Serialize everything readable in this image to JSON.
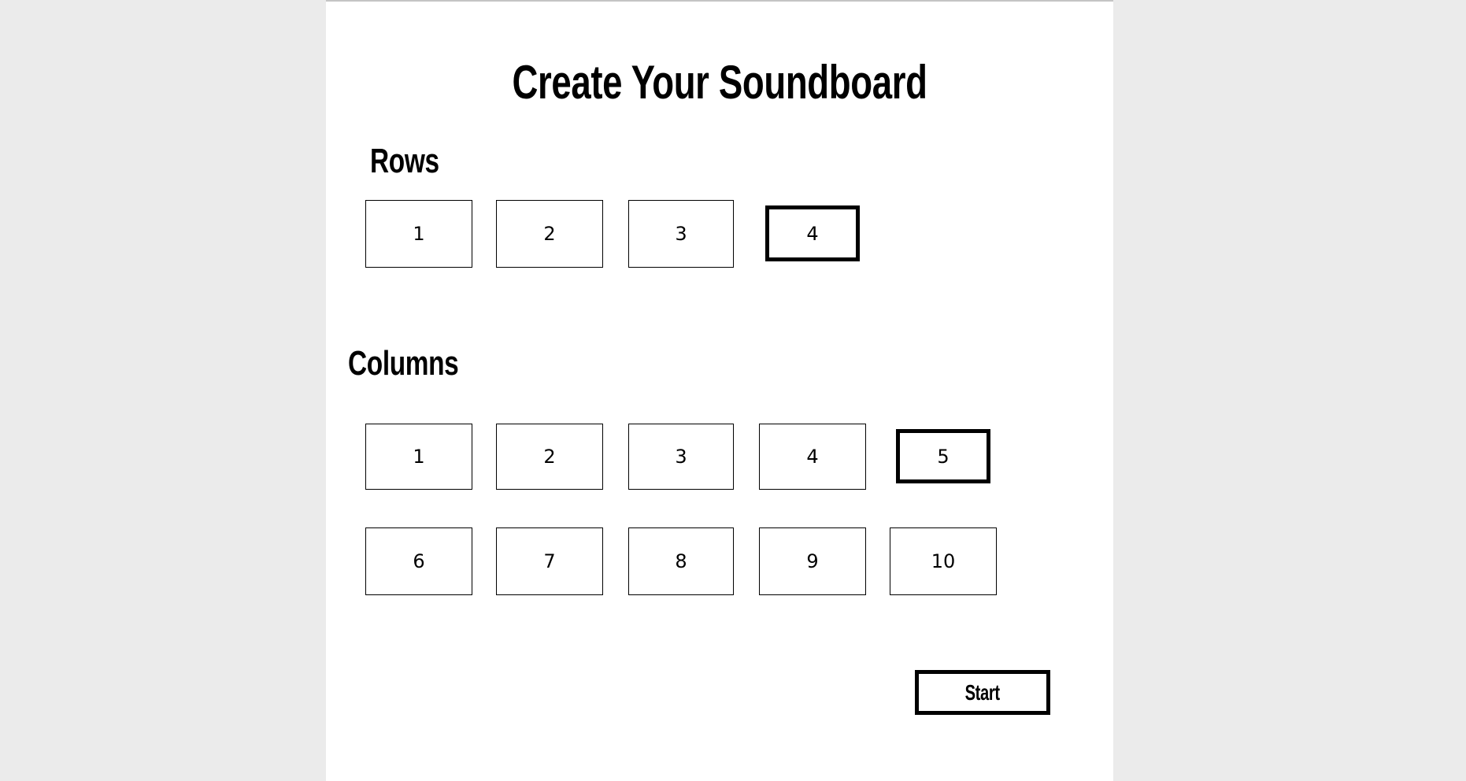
{
  "title": "Create Your Soundboard",
  "rows": {
    "heading": "Rows",
    "options": [
      "1",
      "2",
      "3",
      "4"
    ],
    "selected": "4"
  },
  "columns": {
    "heading": "Columns",
    "options": [
      "1",
      "2",
      "3",
      "4",
      "5",
      "6",
      "7",
      "8",
      "9",
      "10"
    ],
    "selected": "5"
  },
  "start_label": "Start"
}
